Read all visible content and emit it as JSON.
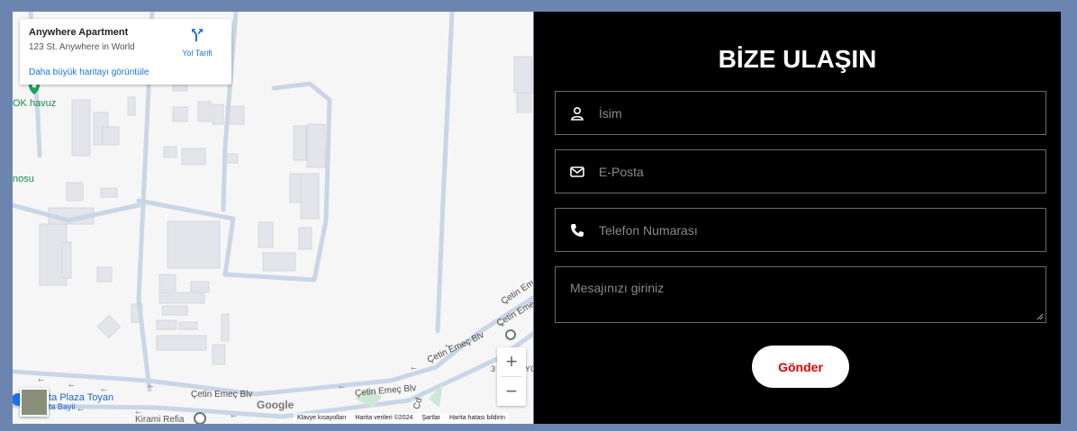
{
  "map": {
    "info_card": {
      "title": "Anywhere Apartment",
      "address": "123 St. Anywhere in World",
      "larger_map_link": "Daha büyük haritayı görüntüle",
      "directions_label": "Yol Tarifi",
      "directions_icon": "directions-arrow-icon"
    },
    "labels": {
      "ok_havuz": "OK havuz",
      "nosu": "nosu",
      "road_1": "Çetin Emeç Blv",
      "road_2": "Çetin Emeç Blv",
      "road_3": "Çetin Emeç Blv",
      "road_4": "Çetin Emeç Blv",
      "road_5": "Çetin Eme",
      "plaza": "ota Plaza Toyan",
      "plaza_sub": "ta Bayii",
      "kirami": "Kirami Refia",
      "cd": "Cd",
      "num_3": "3",
      "yc": "YC"
    },
    "google": "Google",
    "attribution": {
      "shortcuts": "Klavye kısayolları",
      "data": "Harita verileri ©2024",
      "terms": "Şartlar",
      "report": "Harita hatası bildirin"
    },
    "zoom_in": "+",
    "zoom_out": "−",
    "colors": {
      "map_bg": "#f6f6f6",
      "road": "#c9d6e6",
      "building": "#e3e5ea",
      "link": "#1a73e8"
    }
  },
  "form": {
    "title": "BİZE ULAŞIN",
    "name_placeholder": "İsim",
    "name_icon": "user-icon",
    "email_placeholder": "E-Posta",
    "email_icon": "envelope-icon",
    "phone_placeholder": "Telefon Numarası",
    "phone_icon": "phone-icon",
    "message_placeholder": "Mesajınızı giriniz",
    "submit_label": "Gönder",
    "colors": {
      "background": "#000000",
      "border": "#6a6a6a",
      "submit_text": "#e00000"
    }
  },
  "page": {
    "background": "#6b85b0"
  }
}
